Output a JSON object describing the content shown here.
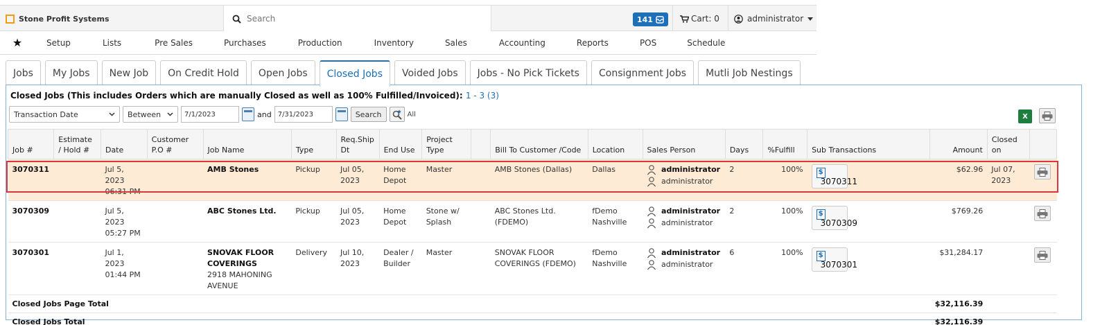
{
  "brand": {
    "name": "Stone Profit Systems"
  },
  "search": {
    "placeholder": "Search"
  },
  "header": {
    "notifications": "141",
    "cart_label": "Cart: 0",
    "user": "administrator"
  },
  "nav": {
    "items": [
      "Setup",
      "Lists",
      "Pre Sales",
      "Purchases",
      "Production",
      "Inventory",
      "Sales",
      "Accounting",
      "Reports",
      "POS",
      "Schedule"
    ]
  },
  "tabs": [
    "Jobs",
    "My Jobs",
    "New Job",
    "On Credit Hold",
    "Open Jobs",
    "Closed Jobs",
    "Voided Jobs",
    "Jobs - No Pick Tickets",
    "Consignment Jobs",
    "Mutli Job Nestings"
  ],
  "active_tab": "Closed Jobs",
  "panel": {
    "title": "Closed Jobs (This includes Orders which are manually Closed as well as 100% Fulfilled/Invoiced):",
    "range": "1 - 3 (3)"
  },
  "filters": {
    "field": "Transaction Date",
    "operator": "Between",
    "from": "7/1/2023",
    "and_label": "and",
    "to": "7/31/2023",
    "search_label": "Search",
    "all_label": "All"
  },
  "columns": [
    "Job #",
    "Estimate / Hold #",
    "Date",
    "Customer P.O #",
    "Job Name",
    "Type",
    "Req.Ship Dt",
    "End Use",
    "Project Type",
    "",
    "Bill To Customer /Code",
    "Location",
    "Sales Person",
    "Days",
    "%Fulfill",
    "Sub Transactions",
    "Amount",
    "Closed on",
    ""
  ],
  "rows": [
    {
      "job": "3070311",
      "estimate": "",
      "date": "Jul 5, 2023",
      "time": "06:31 PM",
      "po": "",
      "name": "AMB Stones",
      "address": "",
      "type": "Pickup",
      "ship": "Jul 05,",
      "ship2": "2023",
      "end_use": "Home",
      "end_use2": "Depot",
      "ptype": "Master",
      "ptype2": "",
      "bill_to": "AMB Stones (Dallas)",
      "location": "Dallas",
      "location2": "",
      "sales1": "administrator",
      "sales2": "administrator",
      "days": "2",
      "fulfill": "100%",
      "sub": "3070311",
      "amount": "$62.96",
      "closed": "Jul 07,",
      "closed2": "2023",
      "highlight": true
    },
    {
      "job": "3070309",
      "estimate": "",
      "date": "Jul 5, 2023",
      "time": "05:27 PM",
      "po": "",
      "name": "ABC Stones Ltd.",
      "address": "",
      "type": "Pickup",
      "ship": "Jul 05,",
      "ship2": "2023",
      "end_use": "Home",
      "end_use2": "Depot",
      "ptype": "Stone w/",
      "ptype2": "Splash",
      "bill_to": "ABC Stones Ltd. (FDEMO)",
      "location": "fDemo",
      "location2": "Nashville",
      "sales1": "administrator",
      "sales2": "administrator",
      "days": "2",
      "fulfill": "100%",
      "sub": "3070309",
      "amount": "$769.26",
      "closed": "",
      "closed2": "",
      "highlight": false
    },
    {
      "job": "3070301",
      "estimate": "",
      "date": "Jul 1, 2023",
      "time": "01:44 PM",
      "po": "",
      "name": "SNOVAK FLOOR COVERINGS",
      "address": "2918 MAHONING AVENUE",
      "type": "Delivery",
      "ship": "Jul 10,",
      "ship2": "2023",
      "end_use": "Dealer /",
      "end_use2": "Builder",
      "ptype": "Master",
      "ptype2": "",
      "bill_to": "SNOVAK FLOOR COVERINGS (FDEMO)",
      "location": "fDemo",
      "location2": "Nashville",
      "sales1": "administrator",
      "sales2": "administrator",
      "days": "6",
      "fulfill": "100%",
      "sub": "3070301",
      "amount": "$31,284.17",
      "closed": "",
      "closed2": "",
      "highlight": false
    }
  ],
  "totals": {
    "page_label": "Closed Jobs Page Total",
    "page_amount": "$32,116.39",
    "all_label": "Closed Jobs Total",
    "all_amount": "$32,116.39"
  },
  "colors": {
    "accent": "#1d6fb8",
    "highlight_border": "#d9363e",
    "highlight_bg": "#fdebd6"
  }
}
